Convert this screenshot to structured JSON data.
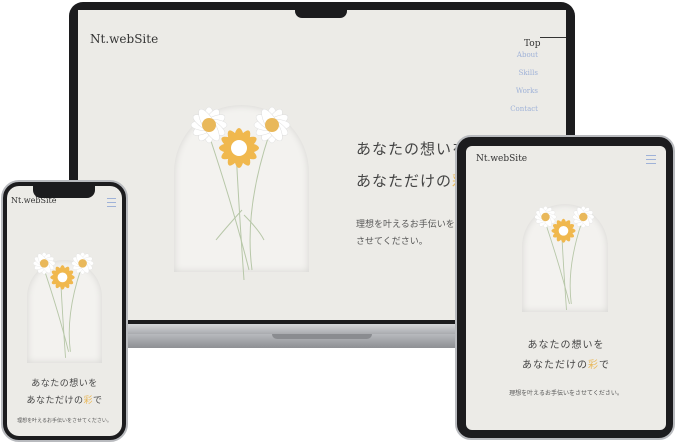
{
  "brand": "Nt.webSite",
  "nav": {
    "top": "Top",
    "items": [
      "About",
      "Skills",
      "Works",
      "Contact"
    ]
  },
  "hero": {
    "line1": "あなたの想いを",
    "line2_prefix": "あなただけの",
    "line2_accent": "彩",
    "line2_suffix": "で",
    "desktop_line1_visible": "あなたの想いを",
    "desktop_line2_visible": "あなただけの",
    "desktop_accent_visible": "彩",
    "sub_line1": "理想を叶えるお手伝いを",
    "sub_line2": "させてください。",
    "sub_full": "理想を叶えるお手伝いをさせてください。"
  },
  "colors": {
    "background": "#ecebe7",
    "accent": "#e9b85a",
    "nav_link": "#9fb2d8",
    "device_frame": "#1c1c1e"
  },
  "icons": {
    "hamburger": "hamburger-menu-icon",
    "flowers": "daisy-bouquet-illustration"
  }
}
